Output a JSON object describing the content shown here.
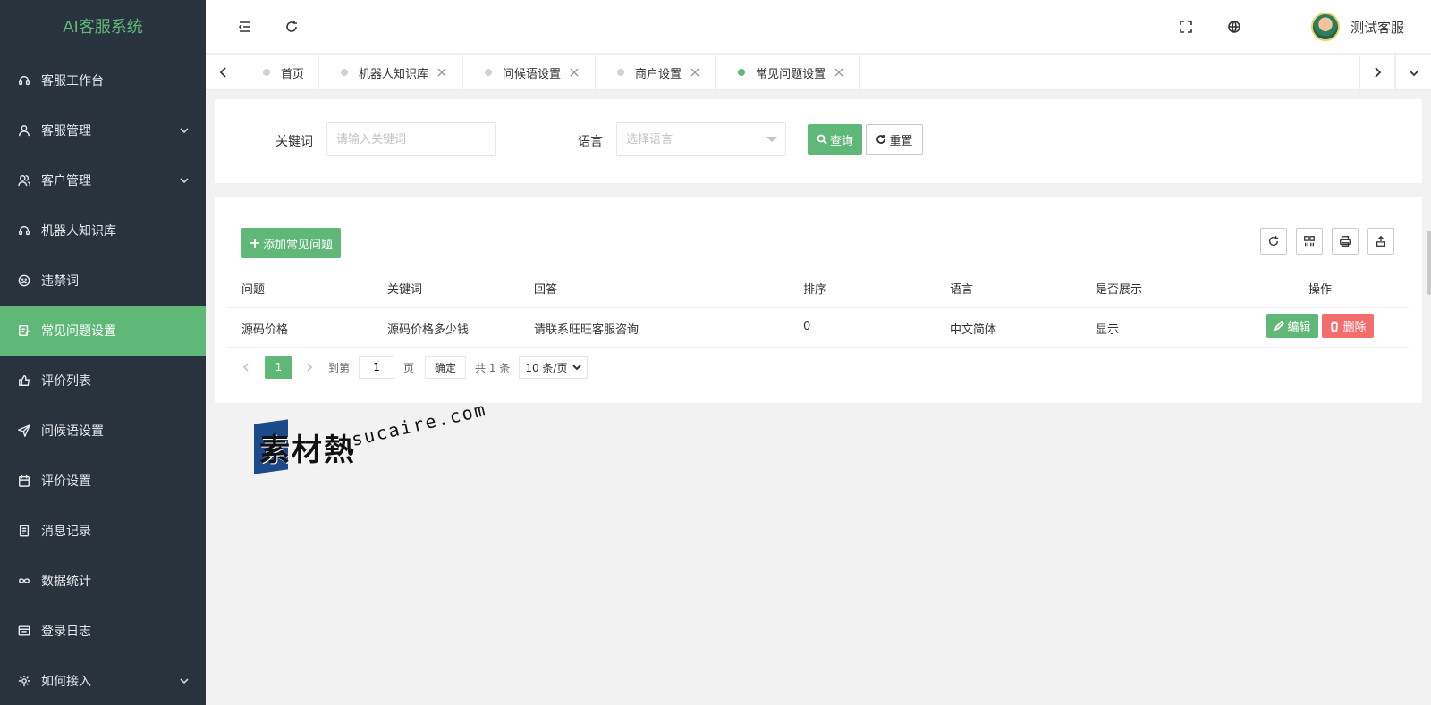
{
  "app": {
    "title": "AI客服系统"
  },
  "sidebar": {
    "items": [
      {
        "label": "客服工作台",
        "icon": "headset-icon",
        "expandable": false,
        "active": false
      },
      {
        "label": "客服管理",
        "icon": "user-icon",
        "expandable": true,
        "active": false
      },
      {
        "label": "客户管理",
        "icon": "users-icon",
        "expandable": true,
        "active": false
      },
      {
        "label": "机器人知识库",
        "icon": "headset-icon",
        "expandable": false,
        "active": false
      },
      {
        "label": "违禁词",
        "icon": "face-icon",
        "expandable": false,
        "active": false
      },
      {
        "label": "常见问题设置",
        "icon": "note-icon",
        "expandable": false,
        "active": true
      },
      {
        "label": "评价列表",
        "icon": "thumb-icon",
        "expandable": false,
        "active": false
      },
      {
        "label": "问候语设置",
        "icon": "send-icon",
        "expandable": false,
        "active": false
      },
      {
        "label": "评价设置",
        "icon": "calendar-icon",
        "expandable": false,
        "active": false
      },
      {
        "label": "消息记录",
        "icon": "doc-icon",
        "expandable": false,
        "active": false
      },
      {
        "label": "数据统计",
        "icon": "infinity-icon",
        "expandable": false,
        "active": false
      },
      {
        "label": "登录日志",
        "icon": "window-icon",
        "expandable": false,
        "active": false
      },
      {
        "label": "如何接入",
        "icon": "gear-icon",
        "expandable": true,
        "active": false
      }
    ]
  },
  "header": {
    "user_name": "测试客服"
  },
  "tabs": [
    {
      "label": "首页",
      "closable": false,
      "active": false
    },
    {
      "label": "机器人知识库",
      "closable": true,
      "active": false
    },
    {
      "label": "问候语设置",
      "closable": true,
      "active": false
    },
    {
      "label": "商户设置",
      "closable": true,
      "active": false
    },
    {
      "label": "常见问题设置",
      "closable": true,
      "active": true
    }
  ],
  "search": {
    "keyword_label": "关键词",
    "keyword_placeholder": "请输入关键词",
    "language_label": "语言",
    "language_placeholder": "选择语言",
    "query_label": "查询",
    "reset_label": "重置"
  },
  "table": {
    "add_label": "添加常见问题",
    "columns": [
      "问题",
      "关键词",
      "回答",
      "排序",
      "语言",
      "是否展示",
      "操作"
    ],
    "rows": [
      {
        "question": "源码价格",
        "keyword": "源码价格多少钱",
        "answer": "请联系旺旺客服咨询",
        "sort": "0",
        "language": "中文简体",
        "show": "显示",
        "edit_label": "编辑",
        "delete_label": "删除"
      }
    ]
  },
  "pager": {
    "current": "1",
    "goto_prefix": "到第",
    "goto_value": "1",
    "goto_suffix": "页",
    "confirm_label": "确定",
    "total": "共 1 条",
    "page_size": "10 条/页"
  },
  "watermark": {
    "cn": "素材熱",
    "en": "sucaire.com"
  },
  "colors": {
    "sidebar_bg": "#28333e",
    "accent": "#5fb878",
    "danger": "#ff5722"
  }
}
